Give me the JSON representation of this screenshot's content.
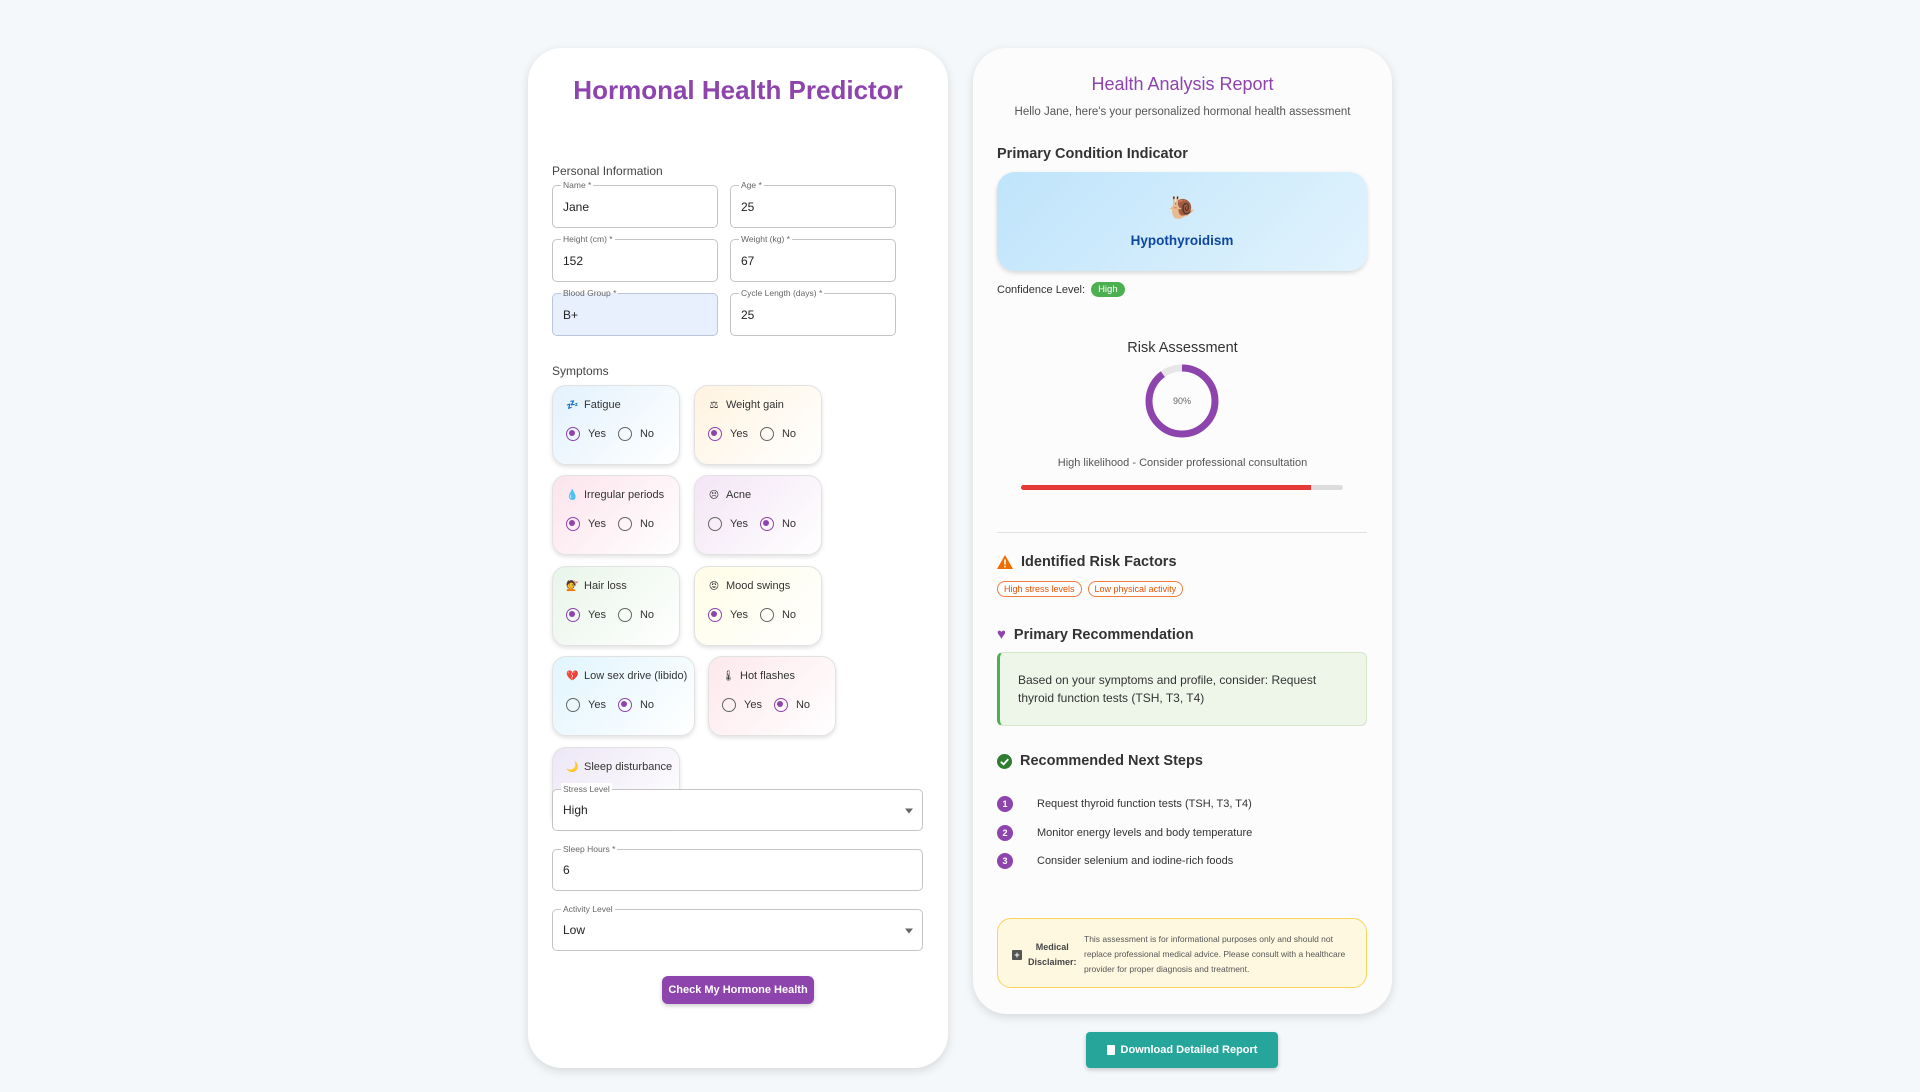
{
  "form": {
    "title": "Hormonal Health Predictor",
    "personal_section": "Personal Information",
    "fields": [
      {
        "label": "Name *",
        "value": "Jane"
      },
      {
        "label": "Age *",
        "value": "25"
      },
      {
        "label": "Height (cm) *",
        "value": "152"
      },
      {
        "label": "Weight (kg) *",
        "value": "67"
      },
      {
        "label": "Blood Group *",
        "value": "B+"
      },
      {
        "label": "Cycle Length (days) *",
        "value": "25"
      }
    ],
    "symptoms_section": "Symptoms",
    "symptoms": [
      {
        "name": "Fatigue",
        "icon": "sleep-icon",
        "glyph": "💤",
        "answer": "Yes"
      },
      {
        "name": "Weight gain",
        "icon": "scale-icon",
        "glyph": "⚖",
        "answer": "Yes"
      },
      {
        "name": "Irregular periods",
        "icon": "drop-icon",
        "glyph": "💧",
        "answer": "Yes"
      },
      {
        "name": "Acne",
        "icon": "face-icon",
        "glyph": "😣",
        "answer": "No"
      },
      {
        "name": "Hair loss",
        "icon": "hair-icon",
        "glyph": "💇",
        "answer": "Yes"
      },
      {
        "name": "Mood swings",
        "icon": "angry-face-icon",
        "glyph": "😡",
        "answer": "Yes"
      },
      {
        "name": "Low sex drive (libido)",
        "icon": "broken-heart-icon",
        "glyph": "💔",
        "answer": "No"
      },
      {
        "name": "Hot flashes",
        "icon": "thermometer-icon",
        "glyph": "🌡",
        "answer": "No"
      },
      {
        "name": "Sleep disturbance",
        "icon": "moon-icon",
        "glyph": "🌙",
        "answer": "Yes"
      }
    ],
    "yes_label": "Yes",
    "no_label": "No",
    "stress": {
      "label": "Stress Level",
      "value": "High"
    },
    "sleep": {
      "label": "Sleep Hours *",
      "value": "6"
    },
    "activity": {
      "label": "Activity Level",
      "value": "Low"
    },
    "submit_label": "Check My Hormone Health"
  },
  "report": {
    "title": "Health Analysis Report",
    "subtitle": "Hello Jane, here's your personalized hormonal health assessment",
    "primary_heading": "Primary Condition Indicator",
    "condition_icon": "snail-icon",
    "condition_glyph": "🐌",
    "condition": "Hypothyroidism",
    "confidence_label": "Confidence Level:",
    "confidence": "High",
    "risk_heading": "Risk Assessment",
    "risk_percent": 90,
    "risk_text": "90%",
    "risk_note": "High likelihood - Consider professional consultation",
    "risk_bar_fraction": 0.9,
    "risk_factors_heading": "Identified Risk Factors",
    "risk_factors": [
      "High stress levels",
      "Low physical activity"
    ],
    "recommendation_heading": "Primary Recommendation",
    "recommendation": "Based on your symptoms and profile, consider: Request thyroid function tests (TSH, T3, T4)",
    "next_steps_heading": "Recommended Next Steps",
    "next_steps": [
      "Request thyroid function tests (TSH, T3, T4)",
      "Monitor energy levels and body temperature",
      "Consider selenium and iodine-rich foods"
    ],
    "disclaimer_label_1": "Medical",
    "disclaimer_label_2": "Disclaimer:",
    "disclaimer_text": "This assessment is for informational purposes only and should not replace professional medical advice. Please consult with a healthcare provider for proper diagnosis and treatment."
  },
  "download_label": "Download Detailed Report",
  "colors": {
    "accent": "#8e44ad",
    "condition_text": "#0d47a1",
    "confidence_badge": "#4caf50",
    "risk_bar": "#e53935",
    "download": "#26a69a"
  }
}
